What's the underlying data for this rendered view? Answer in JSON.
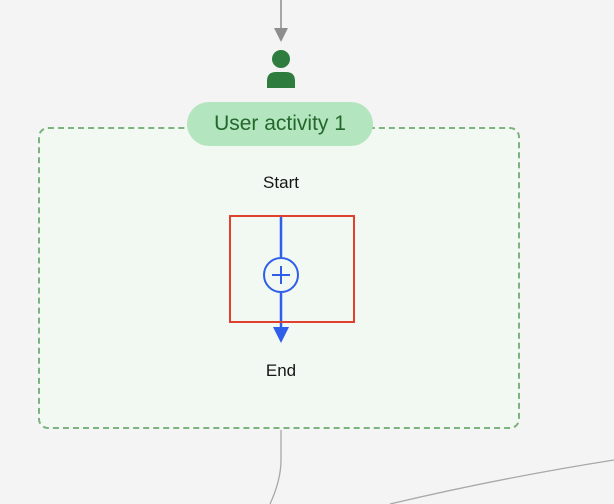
{
  "activity": {
    "name": "User activity 1",
    "start_label": "Start",
    "end_label": "End"
  },
  "icons": {
    "user": "person-icon",
    "add_step": "plus-circle-icon",
    "flow_arrow": "arrow-down-icon"
  },
  "colors": {
    "canvas_background": "#f4f4f4",
    "activity_border": "#7db37f",
    "activity_fill": "#f2f8f2",
    "pill_background": "#b3e6be",
    "pill_text": "#24672d",
    "user_icon": "#2e7d3e",
    "flow_line": "#2f5fe8",
    "highlight": "#e0402e",
    "connector": "#a8a8a8",
    "incoming_arrow": "#8d8d8d"
  }
}
